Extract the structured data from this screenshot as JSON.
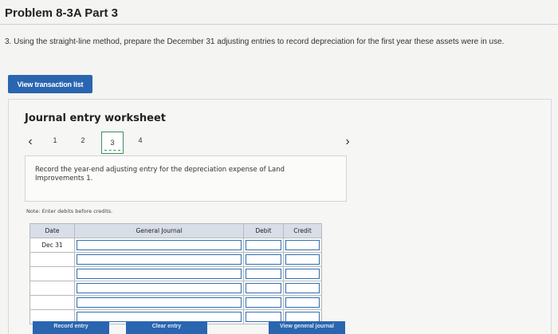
{
  "problem_title": "Problem 8-3A Part 3",
  "instruction": "3. Using the straight-line method, prepare the December 31 adjusting entries to record depreciation for the first year these assets were in use.",
  "view_transaction_button": "View transaction list",
  "worksheet": {
    "title": "Journal entry worksheet",
    "prev_icon": "chevron-left-icon",
    "next_icon": "chevron-right-icon",
    "pages": [
      "1",
      "2",
      "3",
      "4"
    ],
    "active_page": "3",
    "task_text": "Record the year-end adjusting entry for the depreciation expense of Land Improvements 1.",
    "note": "Note: Enter debits before credits.",
    "table": {
      "headers": {
        "date": "Date",
        "general_journal": "General Journal",
        "debit": "Debit",
        "credit": "Credit"
      },
      "rows": [
        {
          "date": "Dec 31"
        },
        {
          "date": ""
        },
        {
          "date": ""
        },
        {
          "date": ""
        },
        {
          "date": ""
        },
        {
          "date": ""
        }
      ]
    },
    "buttons": {
      "record": "Record entry",
      "clear": "Clear entry",
      "view_journal": "View general journal"
    }
  },
  "colors": {
    "button_blue": "#2a65b0",
    "input_border": "#2f6fb3",
    "active_page_border": "#3c8d5a",
    "header_bg": "#d7dee8"
  }
}
